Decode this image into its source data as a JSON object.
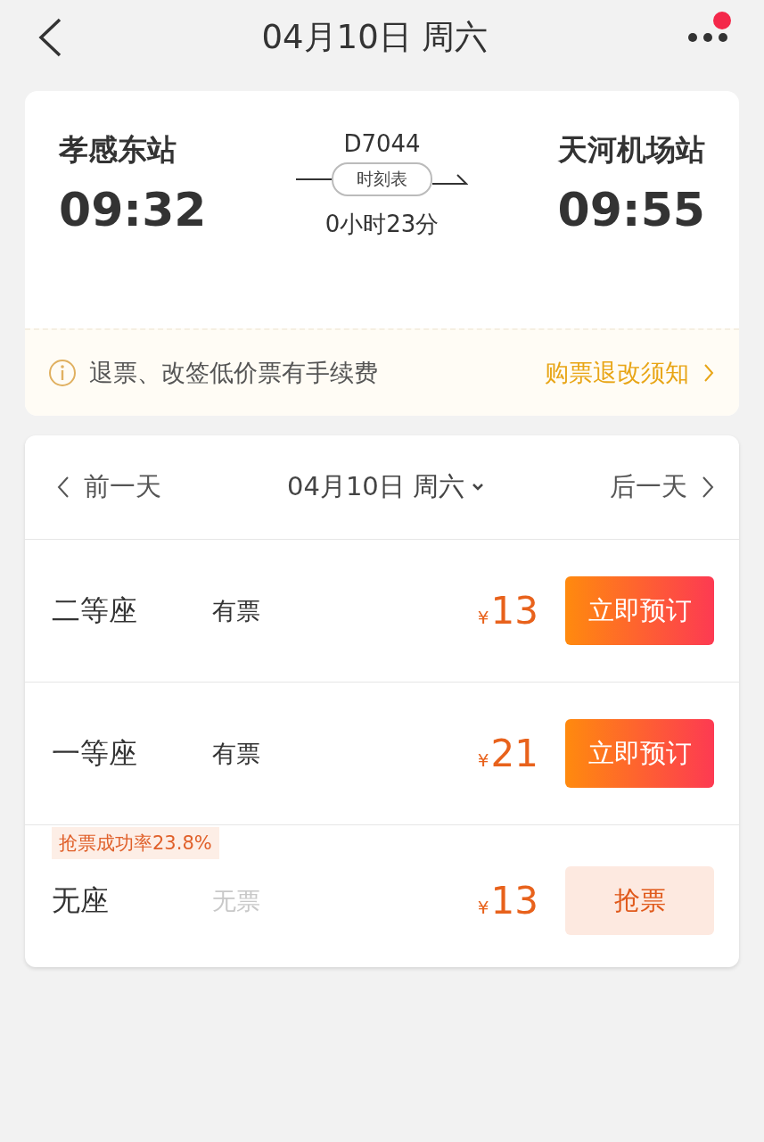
{
  "header": {
    "title": "04月10日 周六",
    "has_notification": true
  },
  "train": {
    "from_station": "孝感东站",
    "depart_time": "09:32",
    "train_no": "D7044",
    "timetable_label": "时刻表",
    "duration": "0小时23分",
    "to_station": "天河机场站",
    "arrive_time": "09:55"
  },
  "notice": {
    "text": "退票、改签低价票有手续费",
    "link": "购票退改须知"
  },
  "date_nav": {
    "prev": "前一天",
    "current": "04月10日 周六",
    "next": "后一天"
  },
  "seats": [
    {
      "name": "二等座",
      "availability": "有票",
      "available": true,
      "currency": "¥",
      "price": "13",
      "kind": "book",
      "action": "立即预订"
    },
    {
      "name": "一等座",
      "availability": "有票",
      "available": true,
      "currency": "¥",
      "price": "21",
      "kind": "book",
      "action": "立即预订"
    },
    {
      "name": "无座",
      "availability": "无票",
      "available": false,
      "currency": "¥",
      "price": "13",
      "kind": "grab",
      "action": "抢票",
      "tag": "抢票成功率23.8%"
    }
  ]
}
